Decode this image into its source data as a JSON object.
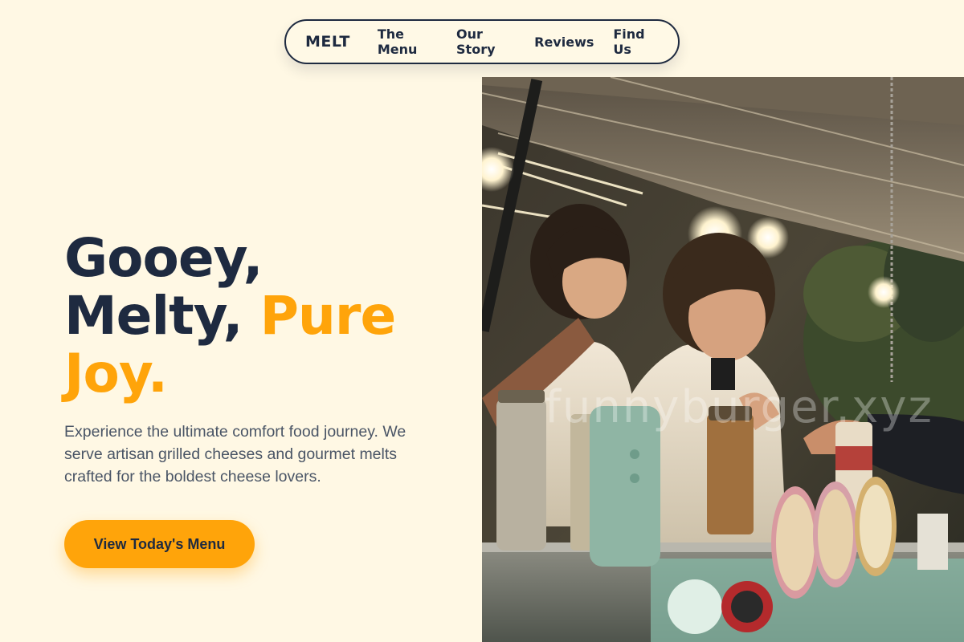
{
  "nav": {
    "brand": "MELT",
    "links": [
      "The Menu",
      "Our Story",
      "Reviews",
      "Find Us"
    ]
  },
  "hero": {
    "headline_line1": "Gooey,",
    "headline_line2a": "Melty, ",
    "headline_line2b": "Pure",
    "headline_line3": "Joy.",
    "subtitle": "Experience the ultimate comfort food journey. We serve artisan grilled cheeses and gourmet melts crafted for the boldest cheese lovers.",
    "cta_label": "View Today's Menu"
  },
  "image": {
    "watermark": "funnyburger.xyz"
  },
  "colors": {
    "background": "#FFF8E4",
    "navy": "#1E2A40",
    "accent": "#FFA40A",
    "body_text": "#4A5566"
  }
}
